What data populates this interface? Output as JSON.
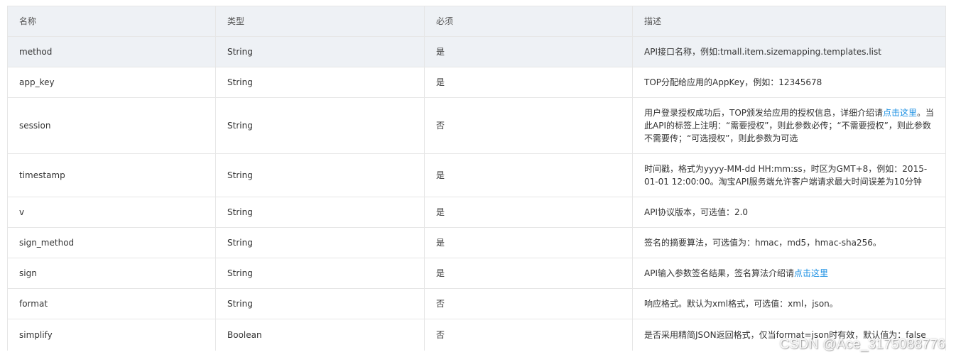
{
  "headers": {
    "name": "名称",
    "type": "类型",
    "required": "必须",
    "description": "描述"
  },
  "rows": [
    {
      "name": "method",
      "type": "String",
      "required": "是",
      "description": "API接口名称，例如:tmall.item.sizemapping.templates.list"
    },
    {
      "name": "app_key",
      "type": "String",
      "required": "是",
      "description": "TOP分配给应用的AppKey，例如：12345678"
    },
    {
      "name": "session",
      "type": "String",
      "required": "否",
      "description_before": "用户登录授权成功后，TOP颁发给应用的授权信息，详细介绍请",
      "description_link": "点击这里",
      "description_after": "。当此API的标签上注明：“需要授权”，则此参数必传；“不需要授权”，则此参数不需要传；“可选授权”，则此参数为可选"
    },
    {
      "name": "timestamp",
      "type": "String",
      "required": "是",
      "description": "时间戳，格式为yyyy-MM-dd HH:mm:ss，时区为GMT+8，例如：2015-01-01 12:00:00。淘宝API服务端允许客户端请求最大时间误差为10分钟"
    },
    {
      "name": "v",
      "type": "String",
      "required": "是",
      "description": "API协议版本，可选值：2.0"
    },
    {
      "name": "sign_method",
      "type": "String",
      "required": "是",
      "description": "签名的摘要算法，可选值为：hmac，md5，hmac-sha256。"
    },
    {
      "name": "sign",
      "type": "String",
      "required": "是",
      "description_before": "API输入参数签名结果，签名算法介绍请",
      "description_link": "点击这里"
    },
    {
      "name": "format",
      "type": "String",
      "required": "否",
      "description": "响应格式。默认为xml格式，可选值：xml，json。"
    },
    {
      "name": "simplify",
      "type": "Boolean",
      "required": "否",
      "description": "是否采用精简JSON返回格式，仅当format=json时有效，默认值为：false"
    }
  ],
  "watermark": "CSDN @Ace_3175088776",
  "colors": {
    "header_bg": "#eef1f5",
    "border": "#e6e6e6",
    "text": "#333333",
    "link": "#1a8fe3"
  }
}
